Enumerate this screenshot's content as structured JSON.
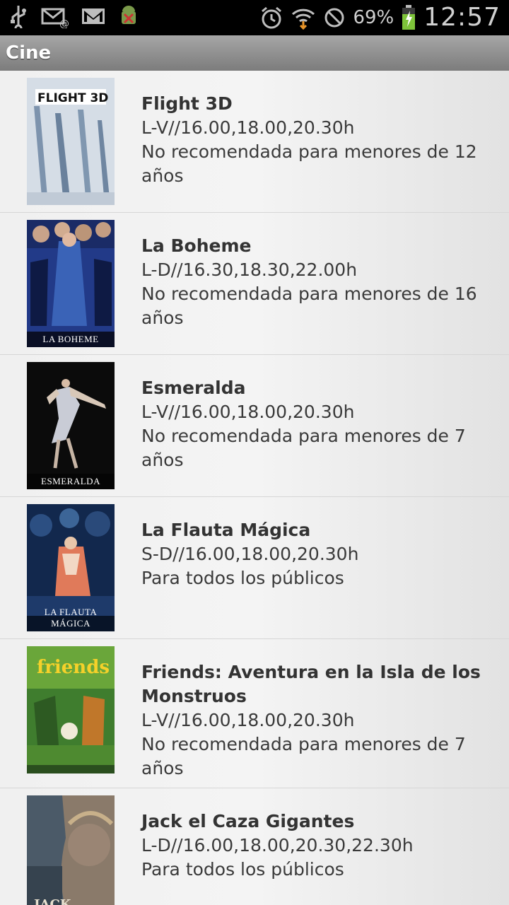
{
  "status_bar": {
    "icons": [
      "usb-icon",
      "email-icon",
      "gmail-icon",
      "android-debug-icon",
      "alarm-icon",
      "wifi-icon",
      "blocked-icon",
      "battery-icon"
    ],
    "battery": "69%",
    "time": "12:57"
  },
  "header": {
    "title": "Cine"
  },
  "movies": [
    {
      "title": "Flight 3D",
      "schedule": "L-V//16.00,18.00,20.30h",
      "rating": "No recomendada para menores de 12 años",
      "poster_caption": "",
      "poster_logo": "FLIGHT 3D",
      "poster_colors": [
        "#c9d3de",
        "#8ea3b8"
      ]
    },
    {
      "title": "La Boheme",
      "schedule": "L-D//16.30,18.30,22.00h",
      "rating": "No recomendada para menores de 16 años",
      "poster_caption": "LA BOHEME",
      "poster_colors": [
        "#1c2c6a",
        "#0d1433"
      ]
    },
    {
      "title": "Esmeralda",
      "schedule": "L-V//16.00,18.00,20.30h",
      "rating": "No recomendada para menores de 7 años",
      "poster_caption": "ESMERALDA",
      "poster_colors": [
        "#0b0b0b",
        "#1a1a1a"
      ]
    },
    {
      "title": "La Flauta Mágica",
      "schedule": "S-D//16.00,18.00,20.30h",
      "rating": "Para todos los públicos",
      "poster_caption": "LA FLAUTA MÁGICA",
      "poster_colors": [
        "#1a3a6a",
        "#0a1530"
      ]
    },
    {
      "title": "Friends: Aventura en la Isla de los Monstruos",
      "schedule": "L-V//16.00,18.00,20.30h",
      "rating": "No recomendada para menores de 7 años",
      "poster_caption": "",
      "poster_logo": "friends",
      "poster_colors": [
        "#2e6e2a",
        "#7aa83a"
      ]
    },
    {
      "title": "Jack el Caza Gigantes",
      "schedule": "L-D//16.00,18.00,20.30,22.30h",
      "rating": "Para todos los públicos",
      "poster_caption": "",
      "poster_logo": "JACK",
      "poster_colors": [
        "#5a6a7a",
        "#2a3038"
      ]
    }
  ]
}
